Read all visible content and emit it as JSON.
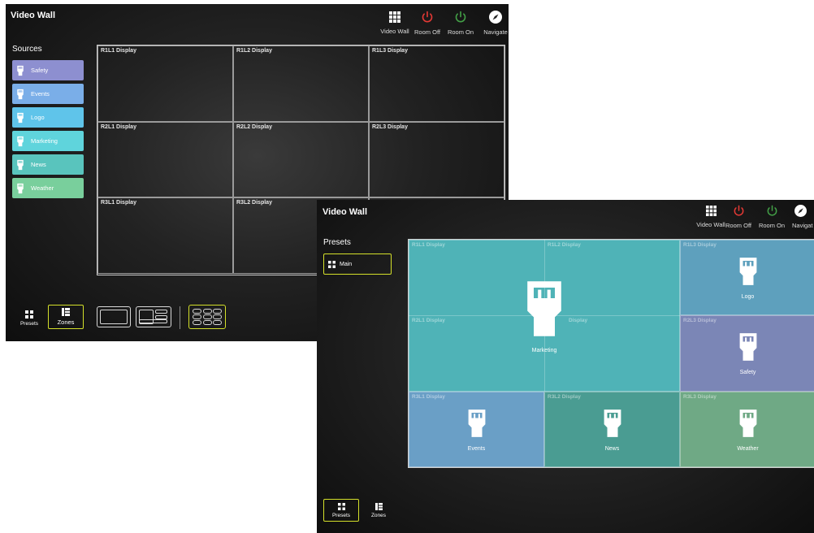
{
  "screen1": {
    "title": "Video Wall",
    "top_buttons": [
      {
        "label": "Video Wall",
        "icon": "grid-icon",
        "color": "#ffffff"
      },
      {
        "label": "Room Off",
        "icon": "power-icon",
        "color": "#e53935"
      },
      {
        "label": "Room On",
        "icon": "power-icon",
        "color": "#43a047"
      },
      {
        "label": "Navigate",
        "icon": "compass-icon",
        "color": "#ffffff"
      }
    ],
    "sources_title": "Sources",
    "sources": [
      {
        "label": "Safety",
        "color": "#8d8fd0"
      },
      {
        "label": "Events",
        "color": "#7aaee8"
      },
      {
        "label": "Logo",
        "color": "#5fc4ea"
      },
      {
        "label": "Marketing",
        "color": "#5fd4dc"
      },
      {
        "label": "News",
        "color": "#59c4bd"
      },
      {
        "label": "Weather",
        "color": "#79cf9c"
      }
    ],
    "displays": [
      "R1L1 Display",
      "R1L2 Display",
      "R1L3 Display",
      "R2L1 Display",
      "R2L2 Display",
      "R2L3 Display",
      "R3L1 Display",
      "R3L2 Display"
    ],
    "bottom": {
      "presets": "Presets",
      "zones": "Zones",
      "active_color": "#d4e02a"
    }
  },
  "screen2": {
    "title": "Video Wall",
    "top_buttons": [
      {
        "label": "Video Wall",
        "icon": "grid-icon",
        "color": "#ffffff"
      },
      {
        "label": "Room Off",
        "icon": "power-icon",
        "color": "#e53935"
      },
      {
        "label": "Room On",
        "icon": "power-icon",
        "color": "#43a047"
      },
      {
        "label": "Navigat",
        "icon": "compass-icon",
        "color": "#ffffff"
      }
    ],
    "presets_title": "Presets",
    "preset_main": "Main",
    "displays": [
      "R1L1 Display",
      "R1L2 Display",
      "R1L3 Display",
      "R2L1 Display",
      "Display",
      "R2L3 Display",
      "R3L1 Display",
      "R3L2 Display",
      "R3L3 Display"
    ],
    "zones": [
      {
        "label": "Marketing",
        "color": "#4fb3b7"
      },
      {
        "label": "Logo",
        "color": "#5ea0bd"
      },
      {
        "label": "Safety",
        "color": "#7b86b6"
      },
      {
        "label": "Events",
        "color": "#6a9fc6"
      },
      {
        "label": "News",
        "color": "#4a9c92"
      },
      {
        "label": "Weather",
        "color": "#6fa985"
      }
    ],
    "bottom": {
      "presets": "Presets",
      "zones": "Zones"
    }
  }
}
